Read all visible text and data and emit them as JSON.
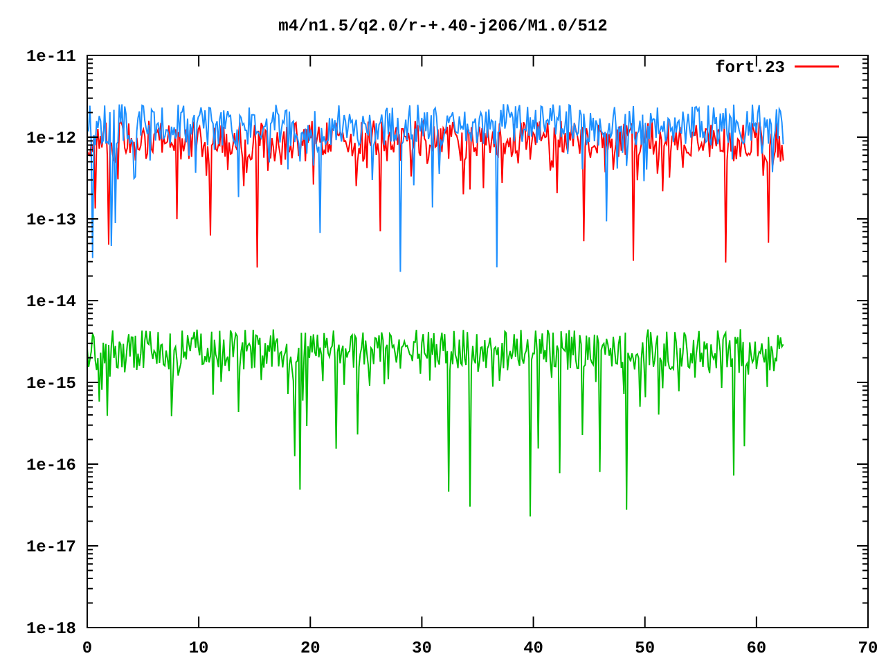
{
  "plot": {
    "title": "m4/n1.5/q2.0/r-+.40-j206/M1.0/512",
    "y_tick_labels": [
      "1e-11",
      "1e-12",
      "1e-13",
      "1e-14",
      "1e-15",
      "1e-16",
      "1e-17",
      "1e-18"
    ],
    "x_tick_labels": [
      "0",
      "10",
      "20",
      "30",
      "40",
      "50",
      "60",
      "70"
    ],
    "legend": [
      {
        "label": "fort.23",
        "color": "#ff0000"
      }
    ]
  }
}
